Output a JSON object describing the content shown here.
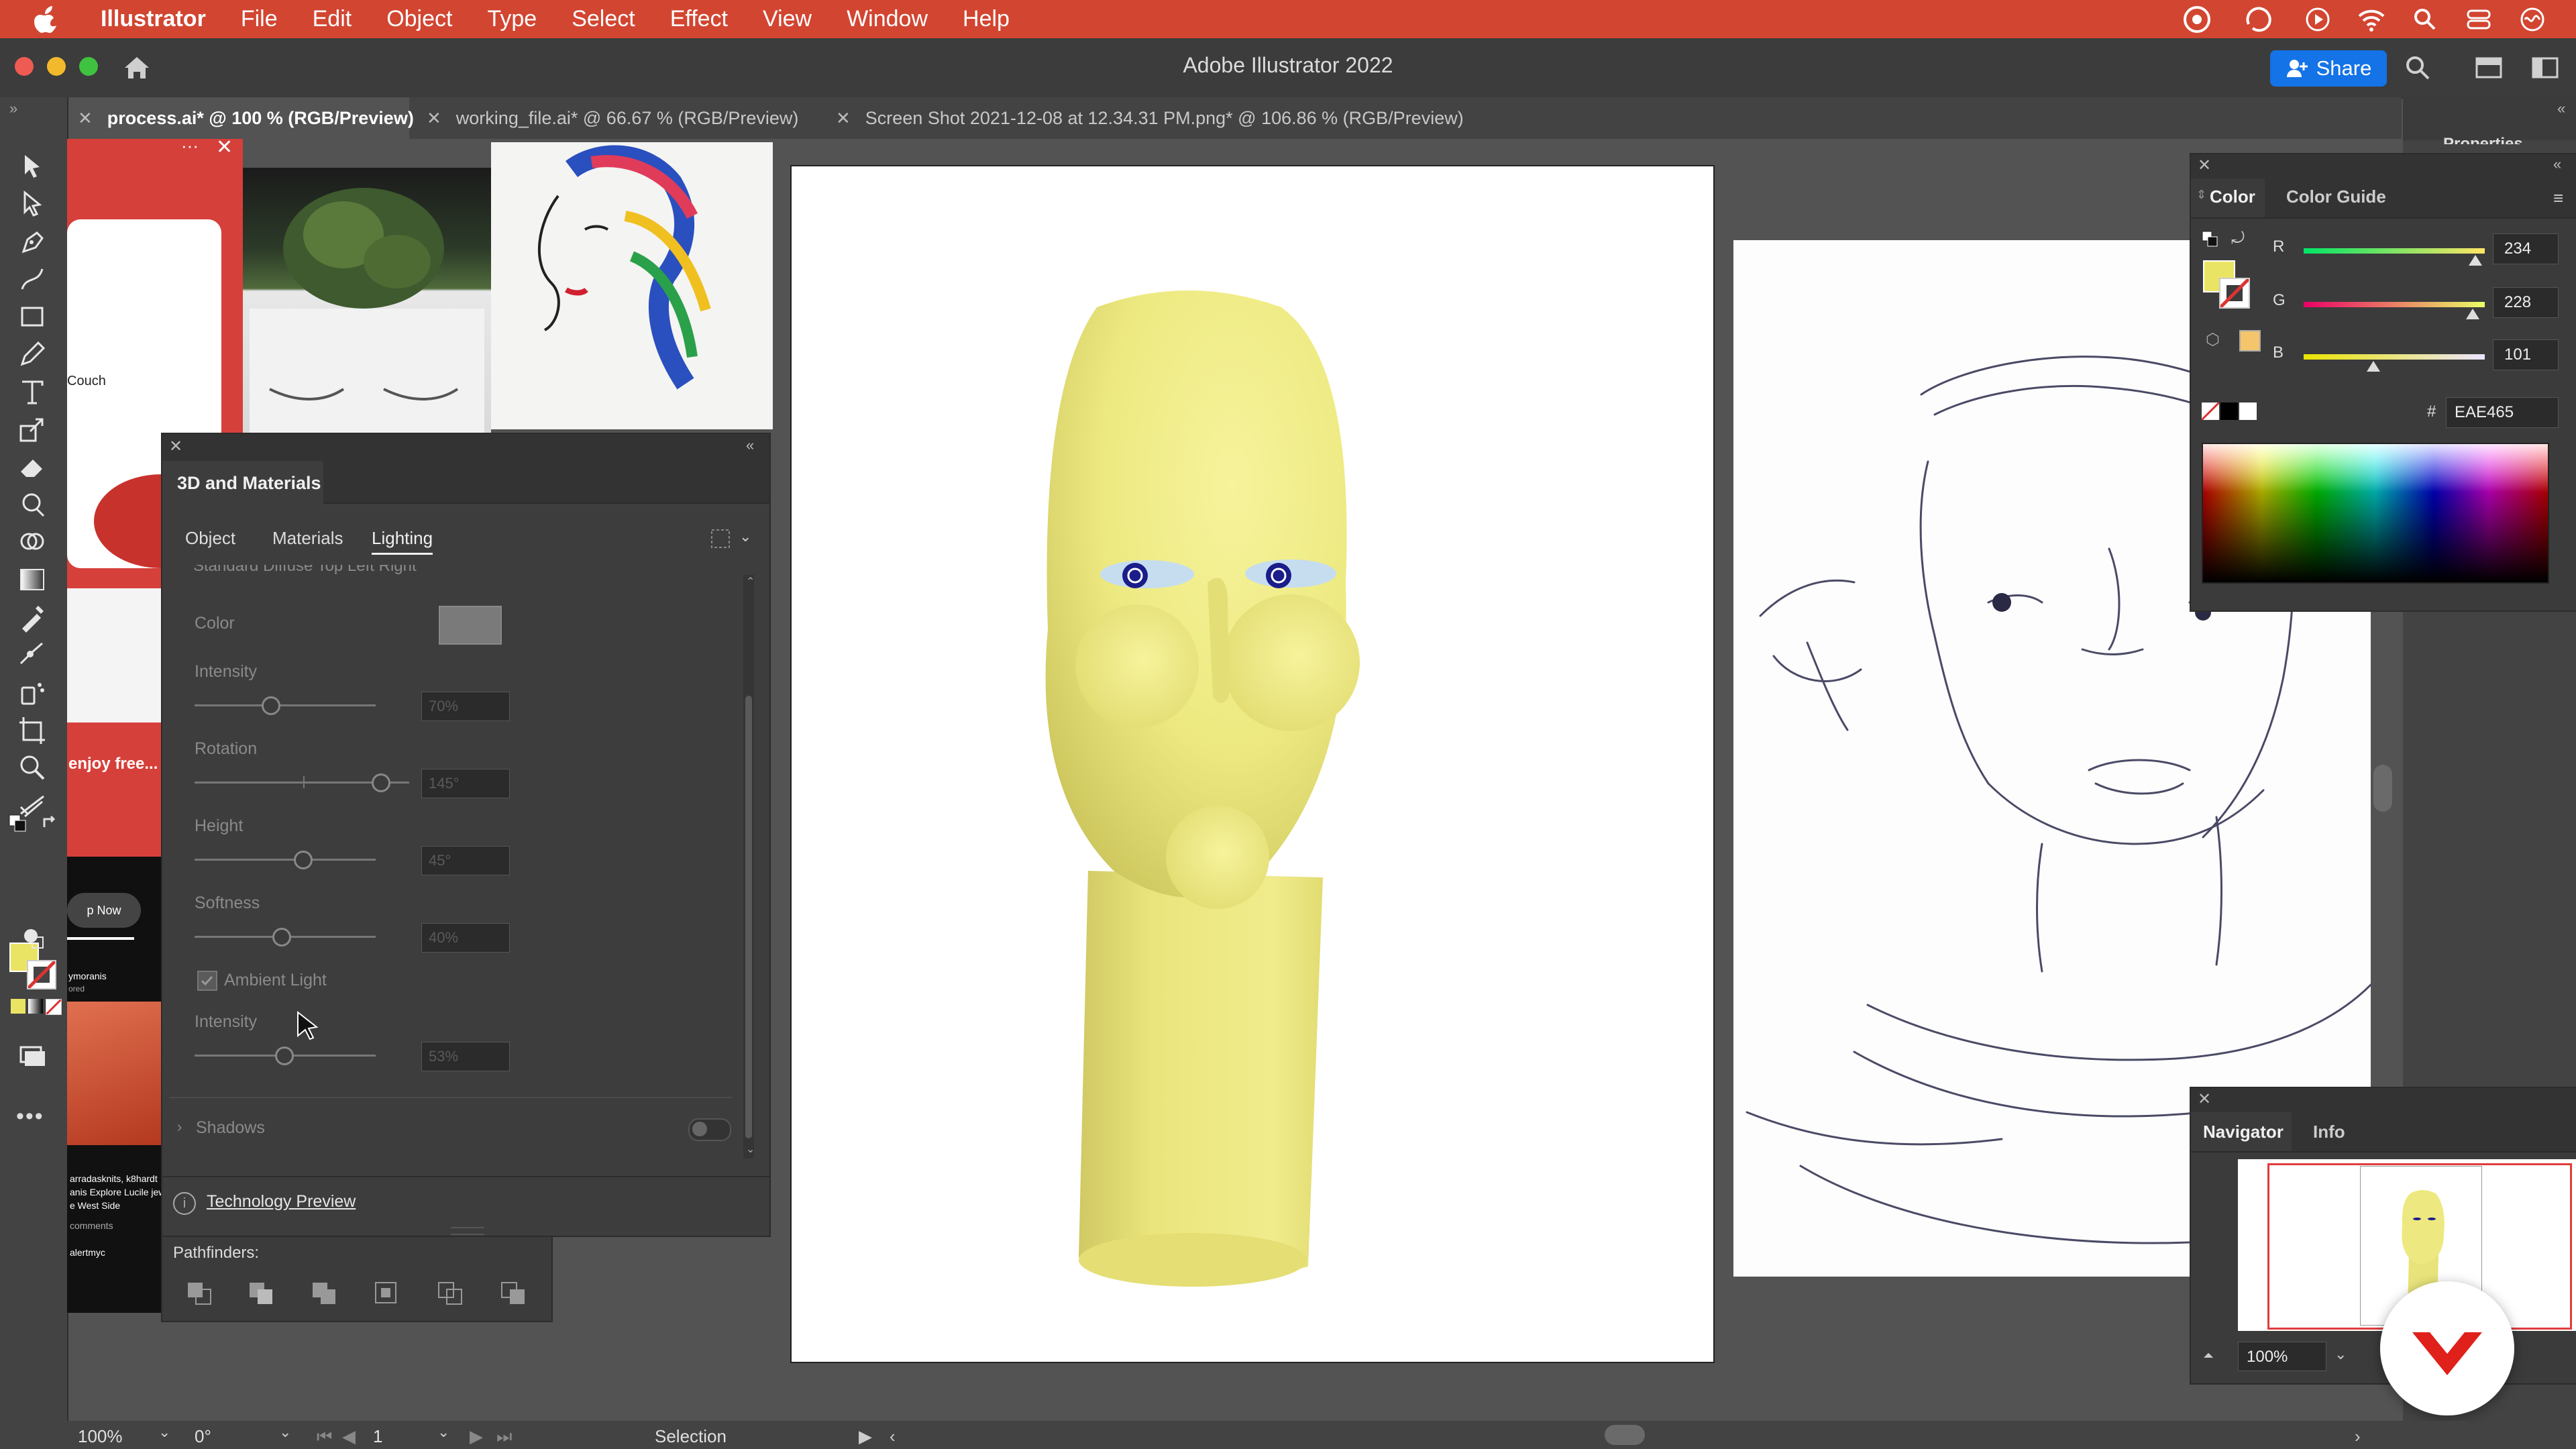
{
  "menu": {
    "app": "Illustrator",
    "items": [
      "File",
      "Edit",
      "Object",
      "Type",
      "Select",
      "Effect",
      "View",
      "Window",
      "Help"
    ]
  },
  "window": {
    "title": "Adobe Illustrator 2022",
    "share_label": "Share"
  },
  "tabs": [
    {
      "label": "process.ai* @ 100 % (RGB/Preview)",
      "active": true
    },
    {
      "label": "working_file.ai* @ 66.67 % (RGB/Preview)",
      "active": false
    },
    {
      "label": "Screen Shot 2021-12-08 at 12.34.31 PM.png* @ 106.86 % (RGB/Preview)",
      "active": false
    }
  ],
  "artboard_left": {
    "couch": "Couch",
    "enjoy": "enjoy free...",
    "shop_now": "p Now",
    "ymoranis": "ymoranis",
    "ored": "ored",
    "social1": "arradasknits, k8hardt",
    "social2": "anis Explore Lucile jew",
    "social3": "e West Side",
    "comments": "comments",
    "alert": "alertmyc"
  },
  "materials_panel": {
    "title": "3D and Materials",
    "tabs": [
      "Object",
      "Materials",
      "Lighting"
    ],
    "active_tab": "Lighting",
    "presets_cut": "Standard   Diffuse   Top Left   Right",
    "color_label": "Color",
    "intensity_label": "Intensity",
    "intensity_value": "70%",
    "intensity_level": 0.7,
    "rotation_label": "Rotation",
    "rotation_value": "145°",
    "height_label": "Height",
    "height_value": "45°",
    "softness_label": "Softness",
    "softness_value": "40%",
    "ambient_label": "Ambient Light",
    "ambient_intensity_label": "Intensity",
    "ambient_intensity_value": "53%",
    "shadows_label": "Shadows",
    "tech_preview": "Technology Preview"
  },
  "pathfinder": {
    "label": "Pathfinders:"
  },
  "color_panel": {
    "tabs": [
      "Color",
      "Color Guide"
    ],
    "r_label": "R",
    "r_value": "234",
    "g_label": "G",
    "g_value": "228",
    "b_label": "B",
    "b_value": "101",
    "hex_symbol": "#",
    "hex_value": "EAE465",
    "fill_color": "#EAE465"
  },
  "navigator_panel": {
    "tabs": [
      "Navigator",
      "Info"
    ],
    "zoom": "100%"
  },
  "properties_cut": "Properties",
  "status": {
    "zoom": "100%",
    "rotation": "0°",
    "artboard_num": "1",
    "tool": "Selection"
  },
  "colors": {
    "menubar": "#d24531",
    "head": "#ede980",
    "accent": "#1473e6"
  }
}
